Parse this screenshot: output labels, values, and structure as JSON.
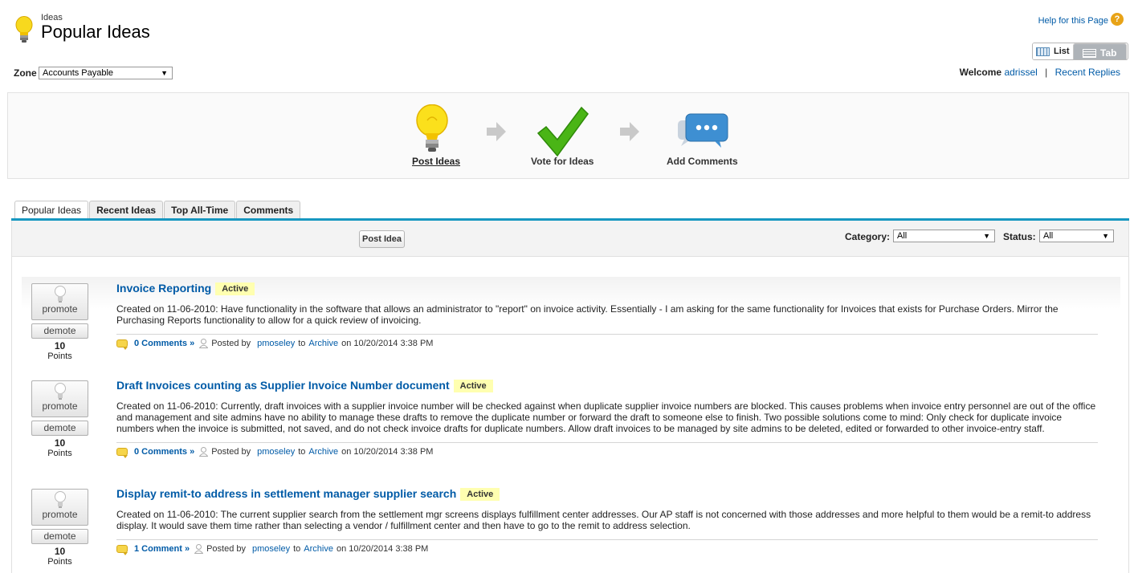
{
  "header": {
    "subtitle": "Ideas",
    "title": "Popular Ideas",
    "help_label": "Help for this Page",
    "help_icon": "?"
  },
  "view_toggle": {
    "list": "List",
    "tab": "Tab"
  },
  "zone": {
    "label": "Zone",
    "value": "Accounts Payable"
  },
  "welcome": {
    "label": "Welcome",
    "user": "adrissel",
    "separator": "|",
    "recent_replies": "Recent Replies"
  },
  "steps": [
    {
      "label": "Post Ideas",
      "icon": "lightbulb-icon"
    },
    {
      "label": "Vote for Ideas",
      "icon": "checkmark-icon"
    },
    {
      "label": "Add Comments",
      "icon": "chat-bubble-icon"
    }
  ],
  "tabs": [
    "Popular Ideas",
    "Recent Ideas",
    "Top All-Time",
    "Comments"
  ],
  "toolbar": {
    "post_idea": "Post Idea",
    "category_label": "Category:",
    "category_value": "All",
    "status_label": "Status:",
    "status_value": "All"
  },
  "vote": {
    "promote": "promote",
    "demote": "demote",
    "points_label": "Points"
  },
  "ideas": [
    {
      "title": "Invoice Reporting",
      "status": "Active",
      "points": "10",
      "body": "Created on 11-06-2010: Have functionality in the software that allows an administrator to \"report\" on invoice activity. Essentially - I am asking for the same functionality for Invoices that exists for Purchase Orders. Mirror the Purchasing Reports functionality to allow for a quick review of invoicing.",
      "comments": "0 Comments »",
      "posted_by": "Posted by",
      "author": "pmoseley",
      "to": "to",
      "zone": "Archive",
      "on": "on 10/20/2014 3:38 PM"
    },
    {
      "title": "Draft Invoices counting as Supplier Invoice Number document",
      "status": "Active",
      "points": "10",
      "body": "Created on 11-06-2010: Currently, draft invoices with a supplier invoice number will be checked against when duplicate supplier invoice numbers are blocked. This causes problems when invoice entry personnel are out of the office and management and site admins have no ability to manage these drafts to remove the duplicate number or forward the draft to someone else to finish. Two possible solutions come to mind: Only check for duplicate invoice numbers when the invoice is submitted, not saved, and do not check invoice drafts for duplicate numbers. Allow draft invoices to be managed by site admins to be deleted, edited or forwarded to other invoice-entry staff.",
      "comments": "0 Comments »",
      "posted_by": "Posted by",
      "author": "pmoseley",
      "to": "to",
      "zone": "Archive",
      "on": "on 10/20/2014 3:38 PM"
    },
    {
      "title": "Display remit-to address in settlement manager supplier search",
      "status": "Active",
      "points": "10",
      "body": "Created on 11-06-2010: The current supplier search from the settlement mgr screens displays fulfillment center addresses. Our AP staff is not concerned with those addresses and more helpful to them would be a remit-to address display. It would save them time rather than selecting a vendor / fulfillment center and then have to go to the remit to address selection.",
      "comments": "1 Comment »",
      "posted_by": "Posted by",
      "author": "pmoseley",
      "to": "to",
      "zone": "Archive",
      "on": "on 10/20/2014 3:38 PM"
    }
  ]
}
